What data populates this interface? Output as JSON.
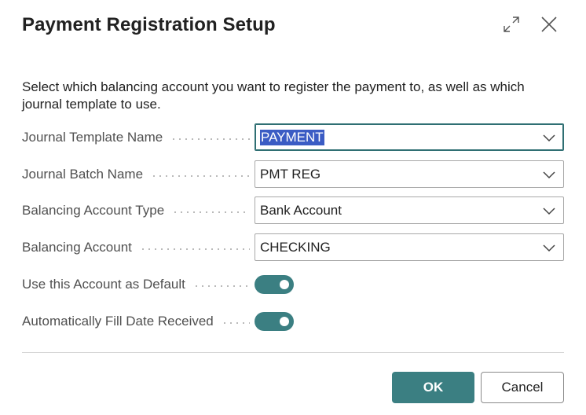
{
  "dialog": {
    "title": "Payment Registration Setup",
    "instruction": "Select which balancing account you want to register the payment to, as well as which journal template to use."
  },
  "fields": {
    "journal_template": {
      "label": "Journal Template Name",
      "value": "PAYMENT"
    },
    "journal_batch": {
      "label": "Journal Batch Name",
      "value": "PMT REG"
    },
    "balancing_account_type": {
      "label": "Balancing Account Type",
      "value": "Bank Account"
    },
    "balancing_account": {
      "label": "Balancing Account",
      "value": "CHECKING"
    },
    "use_as_default": {
      "label": "Use this Account as Default",
      "checked": true
    },
    "auto_fill_date": {
      "label": "Automatically Fill Date Received",
      "checked": true
    }
  },
  "buttons": {
    "ok": "OK",
    "cancel": "Cancel"
  },
  "colors": {
    "accent": "#3b7f82",
    "selection": "#3b5cc4"
  },
  "icons": {
    "expand": "expand-icon",
    "close": "close-icon",
    "dropdown": "chevron-down-icon"
  }
}
